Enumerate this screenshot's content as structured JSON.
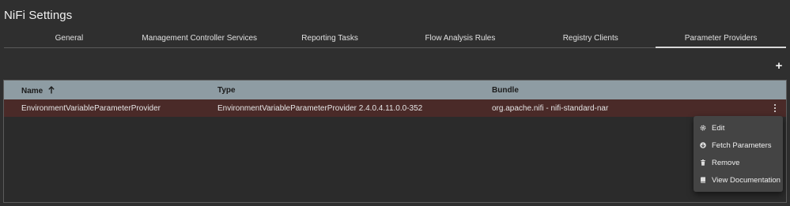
{
  "page": {
    "title": "NiFi Settings"
  },
  "tabs": [
    {
      "label": "General"
    },
    {
      "label": "Management Controller Services"
    },
    {
      "label": "Reporting Tasks"
    },
    {
      "label": "Flow Analysis Rules"
    },
    {
      "label": "Registry Clients"
    },
    {
      "label": "Parameter Providers",
      "active": true
    }
  ],
  "toolbar": {
    "add_icon": "plus-icon",
    "add_label": "+"
  },
  "table": {
    "columns": [
      {
        "label": "Name",
        "sort": "ascending",
        "sort_icon": "arrow-up-icon"
      },
      {
        "label": "Type"
      },
      {
        "label": "Bundle"
      }
    ],
    "rows": [
      {
        "name": "EnvironmentVariableParameterProvider",
        "type": "EnvironmentVariableParameterProvider 2.4.0.4.11.0.0-352",
        "bundle": "org.apache.nifi - nifi-standard-nar",
        "selected": true,
        "actions_icon": "more-vertical-icon"
      }
    ]
  },
  "context_menu": {
    "items": [
      {
        "label": "Edit",
        "icon": "gear-icon"
      },
      {
        "label": "Fetch Parameters",
        "icon": "download-circle-icon"
      },
      {
        "label": "Remove",
        "icon": "trash-icon"
      },
      {
        "label": "View Documentation",
        "icon": "book-icon"
      }
    ]
  },
  "colors": {
    "background": "#2f2f2f",
    "header_row": "#8e9ca3",
    "selected_row": "#4a2a28",
    "menu_bg": "#444444"
  }
}
